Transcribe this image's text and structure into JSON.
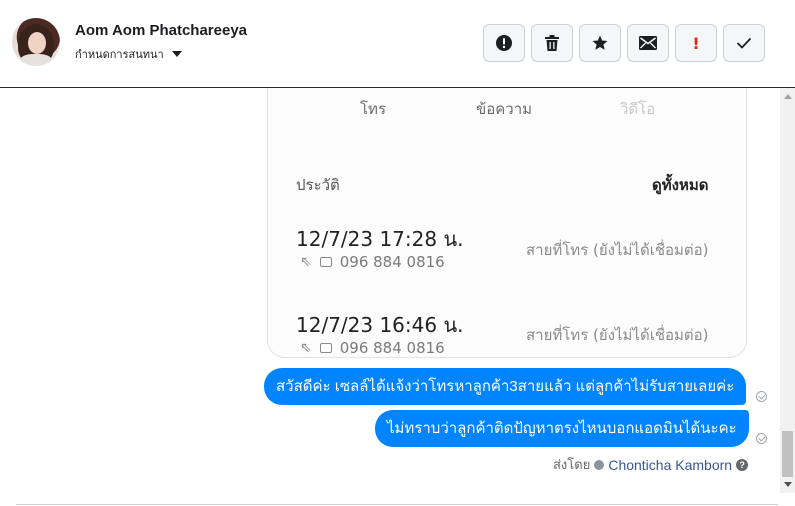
{
  "header": {
    "name": "Aom Aom Phatchareeya",
    "assign_label": "กำหนดการสนทนา",
    "actions": [
      {
        "icon": "alert-circle-icon",
        "label": "Mark as spam"
      },
      {
        "icon": "trash-icon",
        "label": "Delete"
      },
      {
        "icon": "star-icon",
        "label": "Star"
      },
      {
        "icon": "envelope-icon",
        "label": "Mark as unread"
      },
      {
        "icon": "exclamation-icon",
        "label": "!"
      },
      {
        "icon": "check-icon",
        "label": "Done"
      }
    ]
  },
  "shared_image": {
    "call_label": "โทร",
    "message_label": "ข้อความ",
    "video_label": "วิดีโอ",
    "history_label": "ประวัติ",
    "see_all_label": "ดูทั้งหมด",
    "calls": [
      {
        "time": "12/7/23 17:28 น.",
        "number": "096 884 0816",
        "status": "สายที่โทร (ยังไม่ได้เชื่อมต่อ)"
      },
      {
        "time": "12/7/23 16:46 น.",
        "number": "096 884 0816",
        "status": "สายที่โทร (ยังไม่ได้เชื่อมต่อ)"
      }
    ]
  },
  "messages": [
    {
      "text": "สวัสดีค่ะ เซลล์ได้แจ้งว่าโทรหาลูกค้า3สายแล้ว แต่ลูกค้าไม่รับสายเลยค่ะ"
    },
    {
      "text": "ไม่ทราบว่าลูกค้าติดปัญหาตรงไหนบอกแอดมินได้นะคะ"
    }
  ],
  "sent_by": {
    "prefix": "ส่งโดย",
    "agent": "Chonticha Kamborn"
  },
  "colors": {
    "bubble": "#0084ff",
    "call_green": "#4cc56a"
  }
}
